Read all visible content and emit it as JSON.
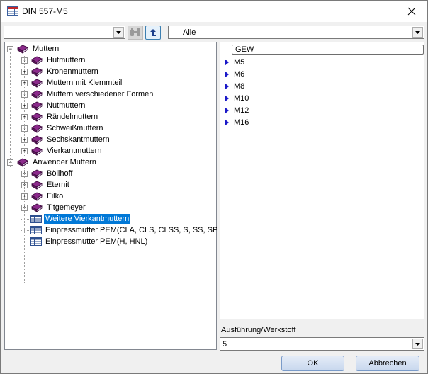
{
  "window": {
    "title": "DIN 557-M5"
  },
  "toolbar": {
    "search_value": "",
    "filter_value": "Alle"
  },
  "tree": {
    "items": [
      {
        "label": "Muttern",
        "expander": "−",
        "icon": "book-icon"
      },
      {
        "label": "Hutmuttern",
        "expander": "+",
        "icon": "book-icon"
      },
      {
        "label": "Kronenmuttern",
        "expander": "+",
        "icon": "book-icon"
      },
      {
        "label": "Muttern mit Klemmteil",
        "expander": "+",
        "icon": "book-icon"
      },
      {
        "label": "Muttern verschiedener Formen",
        "expander": "+",
        "icon": "book-icon"
      },
      {
        "label": "Nutmuttern",
        "expander": "+",
        "icon": "book-icon"
      },
      {
        "label": "Rändelmuttern",
        "expander": "+",
        "icon": "book-icon"
      },
      {
        "label": "Schweißmuttern",
        "expander": "+",
        "icon": "book-icon"
      },
      {
        "label": "Sechskantmuttern",
        "expander": "+",
        "icon": "book-icon"
      },
      {
        "label": "Vierkantmuttern",
        "expander": "+",
        "icon": "book-icon"
      },
      {
        "label": "Anwender Muttern",
        "expander": "−",
        "icon": "book-icon"
      },
      {
        "label": "Böllhoff",
        "expander": "+",
        "icon": "book-icon"
      },
      {
        "label": "Eternit",
        "expander": "+",
        "icon": "book-icon"
      },
      {
        "label": "Filko",
        "expander": "+",
        "icon": "book-icon"
      },
      {
        "label": "Titgemeyer",
        "expander": "+",
        "icon": "book-icon"
      },
      {
        "label": "Weitere Vierkantmuttern",
        "expander": "",
        "icon": "table-icon"
      },
      {
        "label": "Einpressmutter PEM(CLA, CLS, CLSS, S, SS, SP)",
        "expander": "",
        "icon": "table-icon"
      },
      {
        "label": "Einpressmutter PEM(H, HNL)",
        "expander": "",
        "icon": "table-icon"
      }
    ]
  },
  "list": {
    "column_header": "GEW",
    "rows": [
      "M5",
      "M6",
      "M8",
      "M10",
      "M12",
      "M16"
    ]
  },
  "variant": {
    "label": "Ausführung/Werkstoff",
    "value": "5"
  },
  "buttons": {
    "ok": "OK",
    "cancel": "Abbrechen"
  },
  "colors": {
    "selection": "#0078d7",
    "book": "#8b2a8b",
    "marker": "#1a18c8"
  }
}
